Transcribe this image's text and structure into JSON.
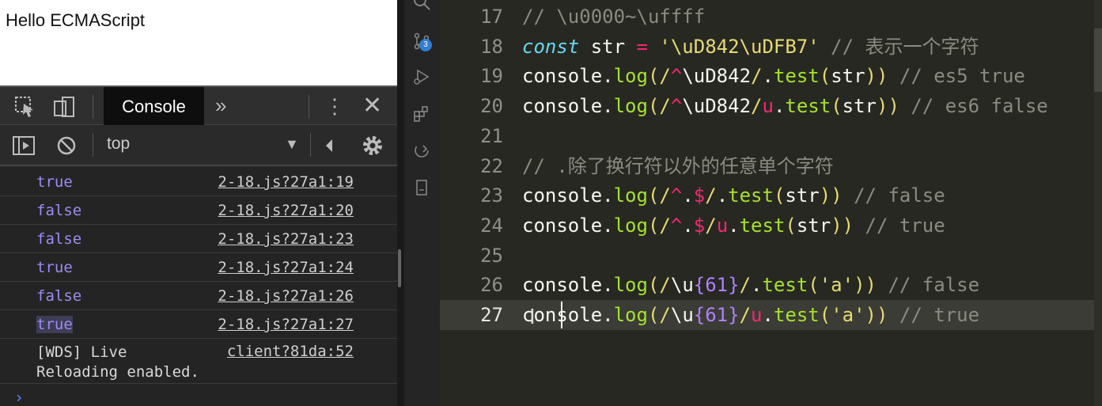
{
  "browser": {
    "page_text": "Hello ECMAScript"
  },
  "devtools": {
    "tab_label": "Console",
    "more_tabs_glyph": "»",
    "menu_glyph": "⋮",
    "close_glyph": "✕",
    "context": "top",
    "context_arrow": "▼",
    "prompt_glyph": "›",
    "logs": [
      {
        "value": "true",
        "source": "2-18.js?27a1:19"
      },
      {
        "value": "false",
        "source": "2-18.js?27a1:20"
      },
      {
        "value": "false",
        "source": "2-18.js?27a1:23"
      },
      {
        "value": "true",
        "source": "2-18.js?27a1:24"
      },
      {
        "value": "false",
        "source": "2-18.js?27a1:26"
      },
      {
        "value": "true",
        "source": "2-18.js?27a1:27"
      }
    ],
    "wds": {
      "message": "[WDS] Live\nReloading enabled.",
      "source": "client?81da:52"
    }
  },
  "activity_bar": {
    "badge": "3",
    "icons": [
      "search-icon",
      "source-control-icon",
      "debug-icon",
      "extensions-icon",
      "remote-icon",
      "file-icon"
    ]
  },
  "editor": {
    "lines": [
      {
        "num": "17",
        "tokens": [
          {
            "t": "// \\u0000~\\uffff",
            "c": "c-cmt"
          }
        ]
      },
      {
        "num": "18",
        "tokens": [
          {
            "t": "const",
            "c": "c-kw"
          },
          {
            "t": " str ",
            "c": "c-p"
          },
          {
            "t": "=",
            "c": "c-op"
          },
          {
            "t": " ",
            "c": "c-p"
          },
          {
            "t": "'\\uD842\\uDFB7'",
            "c": "c-str"
          },
          {
            "t": " // 表示一个字符",
            "c": "c-cmt"
          }
        ]
      },
      {
        "num": "19",
        "tokens": [
          {
            "t": "console",
            "c": "c-p"
          },
          {
            "t": ".",
            "c": "c-p"
          },
          {
            "t": "log",
            "c": "c-fn"
          },
          {
            "t": "(",
            "c": "c-br"
          },
          {
            "t": "/",
            "c": "c-re"
          },
          {
            "t": "^",
            "c": "c-op"
          },
          {
            "t": "\\uD842",
            "c": "c-p"
          },
          {
            "t": "/",
            "c": "c-re"
          },
          {
            "t": ".",
            "c": "c-p"
          },
          {
            "t": "test",
            "c": "c-fn"
          },
          {
            "t": "(",
            "c": "c-br"
          },
          {
            "t": "str",
            "c": "c-p"
          },
          {
            "t": "))",
            "c": "c-br"
          },
          {
            "t": " // es5 true",
            "c": "c-cmt"
          }
        ]
      },
      {
        "num": "20",
        "tokens": [
          {
            "t": "console",
            "c": "c-p"
          },
          {
            "t": ".",
            "c": "c-p"
          },
          {
            "t": "log",
            "c": "c-fn"
          },
          {
            "t": "(",
            "c": "c-br"
          },
          {
            "t": "/",
            "c": "c-re"
          },
          {
            "t": "^",
            "c": "c-op"
          },
          {
            "t": "\\uD842",
            "c": "c-p"
          },
          {
            "t": "/",
            "c": "c-re"
          },
          {
            "t": "u",
            "c": "c-op"
          },
          {
            "t": ".",
            "c": "c-p"
          },
          {
            "t": "test",
            "c": "c-fn"
          },
          {
            "t": "(",
            "c": "c-br"
          },
          {
            "t": "str",
            "c": "c-p"
          },
          {
            "t": "))",
            "c": "c-br"
          },
          {
            "t": " // es6 false",
            "c": "c-cmt"
          }
        ]
      },
      {
        "num": "21",
        "tokens": []
      },
      {
        "num": "22",
        "tokens": [
          {
            "t": "// .除了换行符以外的任意单个字符",
            "c": "c-cmt"
          }
        ]
      },
      {
        "num": "23",
        "tokens": [
          {
            "t": "console",
            "c": "c-p"
          },
          {
            "t": ".",
            "c": "c-p"
          },
          {
            "t": "log",
            "c": "c-fn"
          },
          {
            "t": "(",
            "c": "c-br"
          },
          {
            "t": "/",
            "c": "c-re"
          },
          {
            "t": "^",
            "c": "c-op"
          },
          {
            "t": ".",
            "c": "c-p"
          },
          {
            "t": "$",
            "c": "c-op"
          },
          {
            "t": "/",
            "c": "c-re"
          },
          {
            "t": ".",
            "c": "c-p"
          },
          {
            "t": "test",
            "c": "c-fn"
          },
          {
            "t": "(",
            "c": "c-br"
          },
          {
            "t": "str",
            "c": "c-p"
          },
          {
            "t": "))",
            "c": "c-br"
          },
          {
            "t": " // false",
            "c": "c-cmt"
          }
        ]
      },
      {
        "num": "24",
        "tokens": [
          {
            "t": "console",
            "c": "c-p"
          },
          {
            "t": ".",
            "c": "c-p"
          },
          {
            "t": "log",
            "c": "c-fn"
          },
          {
            "t": "(",
            "c": "c-br"
          },
          {
            "t": "/",
            "c": "c-re"
          },
          {
            "t": "^",
            "c": "c-op"
          },
          {
            "t": ".",
            "c": "c-p"
          },
          {
            "t": "$",
            "c": "c-op"
          },
          {
            "t": "/",
            "c": "c-re"
          },
          {
            "t": "u",
            "c": "c-op"
          },
          {
            "t": ".",
            "c": "c-p"
          },
          {
            "t": "test",
            "c": "c-fn"
          },
          {
            "t": "(",
            "c": "c-br"
          },
          {
            "t": "str",
            "c": "c-p"
          },
          {
            "t": "))",
            "c": "c-br"
          },
          {
            "t": " // true",
            "c": "c-cmt"
          }
        ]
      },
      {
        "num": "25",
        "tokens": []
      },
      {
        "num": "26",
        "tokens": [
          {
            "t": "console",
            "c": "c-p"
          },
          {
            "t": ".",
            "c": "c-p"
          },
          {
            "t": "log",
            "c": "c-fn"
          },
          {
            "t": "(",
            "c": "c-br"
          },
          {
            "t": "/",
            "c": "c-re"
          },
          {
            "t": "\\u",
            "c": "c-p"
          },
          {
            "t": "{61}",
            "c": "c-num"
          },
          {
            "t": "/",
            "c": "c-re"
          },
          {
            "t": ".",
            "c": "c-p"
          },
          {
            "t": "test",
            "c": "c-fn"
          },
          {
            "t": "(",
            "c": "c-br"
          },
          {
            "t": "'a'",
            "c": "c-str"
          },
          {
            "t": "))",
            "c": "c-br"
          },
          {
            "t": " // false",
            "c": "c-cmt"
          }
        ]
      },
      {
        "num": "27",
        "tokens": [
          {
            "t": "console",
            "c": "c-p"
          },
          {
            "t": ".",
            "c": "c-p"
          },
          {
            "t": "log",
            "c": "c-fn"
          },
          {
            "t": "(",
            "c": "c-br"
          },
          {
            "t": "/",
            "c": "c-re"
          },
          {
            "t": "\\u",
            "c": "c-p"
          },
          {
            "t": "{61}",
            "c": "c-num"
          },
          {
            "t": "/",
            "c": "c-re"
          },
          {
            "t": "u",
            "c": "c-op"
          },
          {
            "t": ".",
            "c": "c-p"
          },
          {
            "t": "test",
            "c": "c-fn"
          },
          {
            "t": "(",
            "c": "c-br"
          },
          {
            "t": "'a'",
            "c": "c-str"
          },
          {
            "t": "))",
            "c": "c-br"
          },
          {
            "t": " // true",
            "c": "c-cmt"
          }
        ]
      }
    ],
    "current_line": "27",
    "colors": {
      "background": "#272822",
      "keyword": "#66d9ef",
      "operator": "#f92672",
      "string": "#e6db74",
      "function": "#a6e22e",
      "number": "#ae81ff",
      "comment": "#8b8b80"
    }
  }
}
